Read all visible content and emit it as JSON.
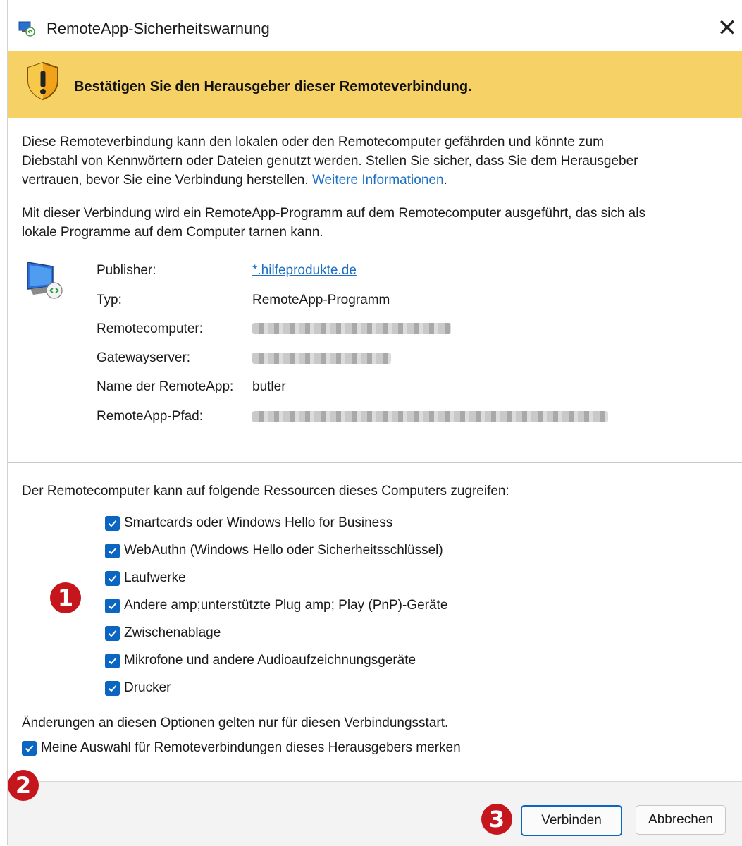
{
  "window": {
    "title": "RemoteApp-Sicherheitswarnung",
    "close_glyph": "✕"
  },
  "banner": {
    "text": "Bestätigen Sie den Herausgeber dieser Remoteverbindung."
  },
  "intro": {
    "line1": "Diese Remoteverbindung kann den lokalen oder den Remotecomputer gefährden und könnte zum",
    "line2": "Diebstahl von Kennwörtern oder Dateien genutzt werden. Stellen Sie sicher, dass Sie dem Herausgeber",
    "line3_text": "vertrauen, bevor Sie eine Verbindung herstellen. ",
    "link": "Weitere Informationen",
    "line3_end": "."
  },
  "program_note": {
    "line1": "Mit dieser Verbindung wird ein RemoteApp-Programm auf dem Remotecomputer ausgeführt, das sich als",
    "line2": "lokale Programme auf dem Computer tarnen kann."
  },
  "details": [
    {
      "label": "Publisher:",
      "value": "*.hilfeprodukte.de"
    },
    {
      "label": "Typ:",
      "value": "RemoteApp-Programm"
    },
    {
      "label": "Remotecomputer:",
      "value": ""
    },
    {
      "label": "Gatewayserver:",
      "value": ""
    },
    {
      "label": "Name der RemoteApp:",
      "value": "butler"
    },
    {
      "label": "RemoteApp-Pfad:",
      "value": ""
    }
  ],
  "resources": {
    "heading": "Der Remotecomputer kann auf folgende Ressourcen dieses Computers zugreifen:",
    "items": [
      {
        "label": "Smartcards oder Windows Hello for Business",
        "checked": true
      },
      {
        "label": "WebAuthn (Windows Hello oder Sicherheitsschlüssel)",
        "checked": true
      },
      {
        "label": "Laufwerke",
        "checked": true
      },
      {
        "label": "Andere amp;unterstützte Plug amp; Play (PnP)-Geräte",
        "checked": true
      },
      {
        "label": "Zwischenablage",
        "checked": true
      },
      {
        "label": "Mikrofone und andere Audioaufzeichnungsgeräte",
        "checked": true
      },
      {
        "label": "Drucker",
        "checked": true
      }
    ],
    "note": "Änderungen an diesen Optionen gelten nur für diesen Verbindungsstart.",
    "remember_label": "Meine Auswahl für Remoteverbindungen dieses Herausgebers merken"
  },
  "buttons": {
    "connect": "Verbinden",
    "cancel": "Abbrechen"
  },
  "annotations": {
    "badge1": "1",
    "badge2": "2",
    "badge3": "3"
  },
  "colors": {
    "banner": "#f6d165",
    "accent": "#0b66c2",
    "link": "#1a6fc4",
    "badge": "#c5161d"
  }
}
